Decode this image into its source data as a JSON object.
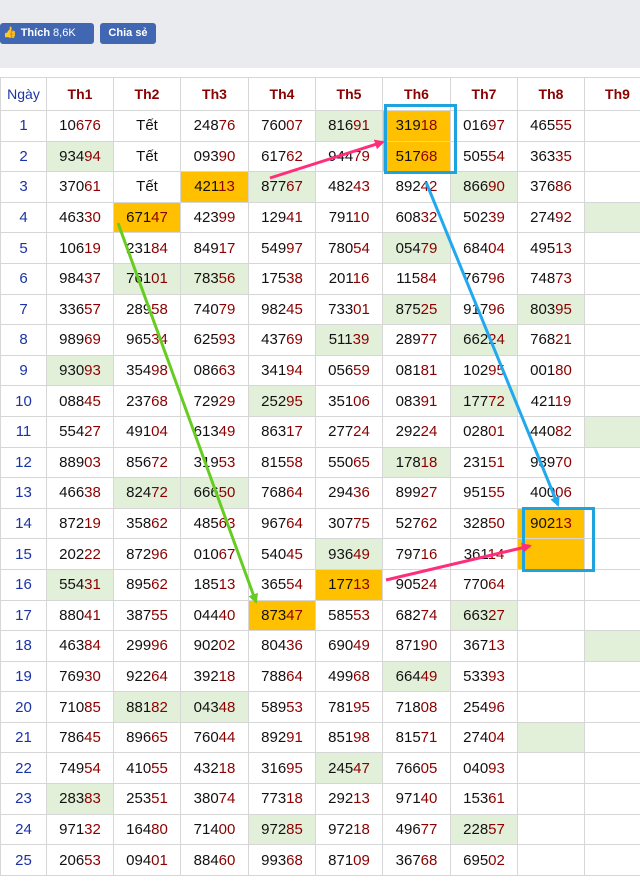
{
  "social": {
    "like_label": "Thích",
    "like_count": "8,6K",
    "share_label": "Chia sẻ",
    "like_icon": "thumbs-up-icon"
  },
  "table": {
    "day_header": "Ngày",
    "columns": [
      "Th1",
      "Th2",
      "Th3",
      "Th4",
      "Th5",
      "Th6",
      "Th7",
      "Th8",
      "Th9"
    ],
    "rows": [
      {
        "day": "1",
        "cells": [
          [
            "10",
            "676"
          ],
          [
            "",
            "Tết"
          ],
          [
            "248",
            "76"
          ],
          [
            "760",
            "07"
          ],
          [
            "816",
            "91"
          ],
          [
            "319",
            "18"
          ],
          [
            "016",
            "97"
          ],
          [
            "465",
            "55"
          ],
          [
            "",
            ""
          ]
        ]
      },
      {
        "day": "2",
        "cells": [
          [
            "934",
            "94"
          ],
          [
            "",
            "Tết"
          ],
          [
            "093",
            "90"
          ],
          [
            "617",
            "62"
          ],
          [
            "944",
            "79"
          ],
          [
            "517",
            "68"
          ],
          [
            "505",
            "54"
          ],
          [
            "363",
            "35"
          ],
          [
            "",
            ""
          ]
        ]
      },
      {
        "day": "3",
        "cells": [
          [
            "370",
            "61"
          ],
          [
            "",
            "Tết"
          ],
          [
            "421",
            "13"
          ],
          [
            "877",
            "67"
          ],
          [
            "482",
            "43"
          ],
          [
            "892",
            "42"
          ],
          [
            "866",
            "90"
          ],
          [
            "376",
            "86"
          ],
          [
            "",
            ""
          ]
        ]
      },
      {
        "day": "4",
        "cells": [
          [
            "463",
            "30"
          ],
          [
            "671",
            "47"
          ],
          [
            "423",
            "99"
          ],
          [
            "129",
            "41"
          ],
          [
            "791",
            "10"
          ],
          [
            "608",
            "32"
          ],
          [
            "502",
            "39"
          ],
          [
            "274",
            "92"
          ],
          [
            "",
            ""
          ]
        ]
      },
      {
        "day": "5",
        "cells": [
          [
            "106",
            "19"
          ],
          [
            "231",
            "84"
          ],
          [
            "849",
            "17"
          ],
          [
            "549",
            "97"
          ],
          [
            "780",
            "54"
          ],
          [
            "054",
            "79"
          ],
          [
            "684",
            "04"
          ],
          [
            "495",
            "13"
          ],
          [
            "",
            ""
          ]
        ]
      },
      {
        "day": "6",
        "cells": [
          [
            "984",
            "37"
          ],
          [
            "761",
            "01"
          ],
          [
            "783",
            "56"
          ],
          [
            "175",
            "38"
          ],
          [
            "201",
            "16"
          ],
          [
            "115",
            "84"
          ],
          [
            "767",
            "96"
          ],
          [
            "748",
            "73"
          ],
          [
            "",
            ""
          ]
        ]
      },
      {
        "day": "7",
        "cells": [
          [
            "336",
            "57"
          ],
          [
            "289",
            "58"
          ],
          [
            "740",
            "79"
          ],
          [
            "982",
            "45"
          ],
          [
            "733",
            "01"
          ],
          [
            "875",
            "25"
          ],
          [
            "917",
            "96"
          ],
          [
            "803",
            "95"
          ],
          [
            "",
            ""
          ]
        ]
      },
      {
        "day": "8",
        "cells": [
          [
            "989",
            "69"
          ],
          [
            "965",
            "34"
          ],
          [
            "625",
            "93"
          ],
          [
            "437",
            "69"
          ],
          [
            "511",
            "39"
          ],
          [
            "289",
            "77"
          ],
          [
            "662",
            "24"
          ],
          [
            "768",
            "21"
          ],
          [
            "",
            ""
          ]
        ]
      },
      {
        "day": "9",
        "cells": [
          [
            "930",
            "93"
          ],
          [
            "354",
            "98"
          ],
          [
            "086",
            "63"
          ],
          [
            "341",
            "94"
          ],
          [
            "056",
            "59"
          ],
          [
            "081",
            "81"
          ],
          [
            "102",
            "95"
          ],
          [
            "001",
            "80"
          ],
          [
            "",
            ""
          ]
        ]
      },
      {
        "day": "10",
        "cells": [
          [
            "088",
            "45"
          ],
          [
            "237",
            "68"
          ],
          [
            "729",
            "29"
          ],
          [
            "252",
            "95"
          ],
          [
            "351",
            "06"
          ],
          [
            "083",
            "91"
          ],
          [
            "177",
            "72"
          ],
          [
            "421",
            "19"
          ],
          [
            "",
            ""
          ]
        ]
      },
      {
        "day": "11",
        "cells": [
          [
            "554",
            "27"
          ],
          [
            "491",
            "04"
          ],
          [
            "613",
            "49"
          ],
          [
            "863",
            "17"
          ],
          [
            "277",
            "24"
          ],
          [
            "292",
            "24"
          ],
          [
            "028",
            "01"
          ],
          [
            "440",
            "82"
          ],
          [
            "",
            ""
          ]
        ]
      },
      {
        "day": "12",
        "cells": [
          [
            "889",
            "03"
          ],
          [
            "856",
            "72"
          ],
          [
            "319",
            "53"
          ],
          [
            "815",
            "58"
          ],
          [
            "550",
            "65"
          ],
          [
            "178",
            "18"
          ],
          [
            "231",
            "51"
          ],
          [
            "939",
            "70"
          ],
          [
            "",
            ""
          ]
        ]
      },
      {
        "day": "13",
        "cells": [
          [
            "466",
            "38"
          ],
          [
            "824",
            "72"
          ],
          [
            "666",
            "50"
          ],
          [
            "768",
            "64"
          ],
          [
            "294",
            "36"
          ],
          [
            "899",
            "27"
          ],
          [
            "951",
            "55"
          ],
          [
            "400",
            "06"
          ],
          [
            "",
            ""
          ]
        ]
      },
      {
        "day": "14",
        "cells": [
          [
            "872",
            "19"
          ],
          [
            "358",
            "62"
          ],
          [
            "485",
            "63"
          ],
          [
            "967",
            "64"
          ],
          [
            "307",
            "75"
          ],
          [
            "527",
            "62"
          ],
          [
            "328",
            "50"
          ],
          [
            "902",
            "13"
          ],
          [
            "",
            ""
          ]
        ]
      },
      {
        "day": "15",
        "cells": [
          [
            "202",
            "22"
          ],
          [
            "872",
            "96"
          ],
          [
            "010",
            "67"
          ],
          [
            "540",
            "45"
          ],
          [
            "936",
            "49"
          ],
          [
            "797",
            "16"
          ],
          [
            "361",
            "14"
          ],
          [
            "",
            ""
          ],
          [
            "",
            ""
          ]
        ]
      },
      {
        "day": "16",
        "cells": [
          [
            "554",
            "31"
          ],
          [
            "895",
            "62"
          ],
          [
            "185",
            "13"
          ],
          [
            "365",
            "54"
          ],
          [
            "177",
            "13"
          ],
          [
            "905",
            "24"
          ],
          [
            "770",
            "64"
          ],
          [
            "",
            ""
          ],
          [
            "",
            ""
          ]
        ]
      },
      {
        "day": "17",
        "cells": [
          [
            "880",
            "41"
          ],
          [
            "387",
            "55"
          ],
          [
            "044",
            "40"
          ],
          [
            "873",
            "47"
          ],
          [
            "585",
            "53"
          ],
          [
            "682",
            "74"
          ],
          [
            "663",
            "27"
          ],
          [
            "",
            ""
          ],
          [
            "",
            ""
          ]
        ]
      },
      {
        "day": "18",
        "cells": [
          [
            "463",
            "84"
          ],
          [
            "299",
            "96"
          ],
          [
            "902",
            "02"
          ],
          [
            "804",
            "36"
          ],
          [
            "690",
            "49"
          ],
          [
            "871",
            "90"
          ],
          [
            "367",
            "13"
          ],
          [
            "",
            ""
          ],
          [
            "",
            ""
          ]
        ]
      },
      {
        "day": "19",
        "cells": [
          [
            "769",
            "30"
          ],
          [
            "922",
            "64"
          ],
          [
            "392",
            "18"
          ],
          [
            "788",
            "64"
          ],
          [
            "499",
            "68"
          ],
          [
            "664",
            "49"
          ],
          [
            "533",
            "93"
          ],
          [
            "",
            ""
          ],
          [
            "",
            ""
          ]
        ]
      },
      {
        "day": "20",
        "cells": [
          [
            "710",
            "85"
          ],
          [
            "881",
            "82"
          ],
          [
            "043",
            "48"
          ],
          [
            "589",
            "53"
          ],
          [
            "781",
            "95"
          ],
          [
            "718",
            "08"
          ],
          [
            "254",
            "96"
          ],
          [
            "",
            ""
          ],
          [
            "",
            ""
          ]
        ]
      },
      {
        "day": "21",
        "cells": [
          [
            "786",
            "45"
          ],
          [
            "896",
            "65"
          ],
          [
            "760",
            "44"
          ],
          [
            "892",
            "91"
          ],
          [
            "851",
            "98"
          ],
          [
            "815",
            "71"
          ],
          [
            "274",
            "04"
          ],
          [
            "",
            ""
          ],
          [
            "",
            ""
          ]
        ]
      },
      {
        "day": "22",
        "cells": [
          [
            "749",
            "54"
          ],
          [
            "410",
            "55"
          ],
          [
            "432",
            "18"
          ],
          [
            "316",
            "95"
          ],
          [
            "245",
            "47"
          ],
          [
            "766",
            "05"
          ],
          [
            "040",
            "93"
          ],
          [
            "",
            ""
          ],
          [
            "",
            ""
          ]
        ]
      },
      {
        "day": "23",
        "cells": [
          [
            "283",
            "83"
          ],
          [
            "253",
            "51"
          ],
          [
            "380",
            "74"
          ],
          [
            "773",
            "18"
          ],
          [
            "292",
            "13"
          ],
          [
            "971",
            "40"
          ],
          [
            "153",
            "61"
          ],
          [
            "",
            ""
          ],
          [
            "",
            ""
          ]
        ]
      },
      {
        "day": "24",
        "cells": [
          [
            "971",
            "32"
          ],
          [
            "164",
            "80"
          ],
          [
            "714",
            "00"
          ],
          [
            "972",
            "85"
          ],
          [
            "972",
            "18"
          ],
          [
            "496",
            "77"
          ],
          [
            "228",
            "57"
          ],
          [
            "",
            ""
          ],
          [
            "",
            ""
          ]
        ]
      },
      {
        "day": "25",
        "cells": [
          [
            "206",
            "53"
          ],
          [
            "094",
            "01"
          ],
          [
            "884",
            "60"
          ],
          [
            "993",
            "68"
          ],
          [
            "871",
            "09"
          ],
          [
            "367",
            "68"
          ],
          [
            "695",
            "02"
          ],
          [
            "",
            ""
          ],
          [
            "",
            ""
          ]
        ]
      }
    ]
  },
  "colors": {
    "header_red": "#8b0000",
    "day_blue": "#1a33a6",
    "green_fill": "#e2f0d9",
    "orange_fill": "#ffc000",
    "arrow_pink": "#ff2d7a",
    "arrow_green": "#66cc22",
    "arrow_blue": "#22a8ee",
    "box_blue": "#1ca3e0"
  }
}
